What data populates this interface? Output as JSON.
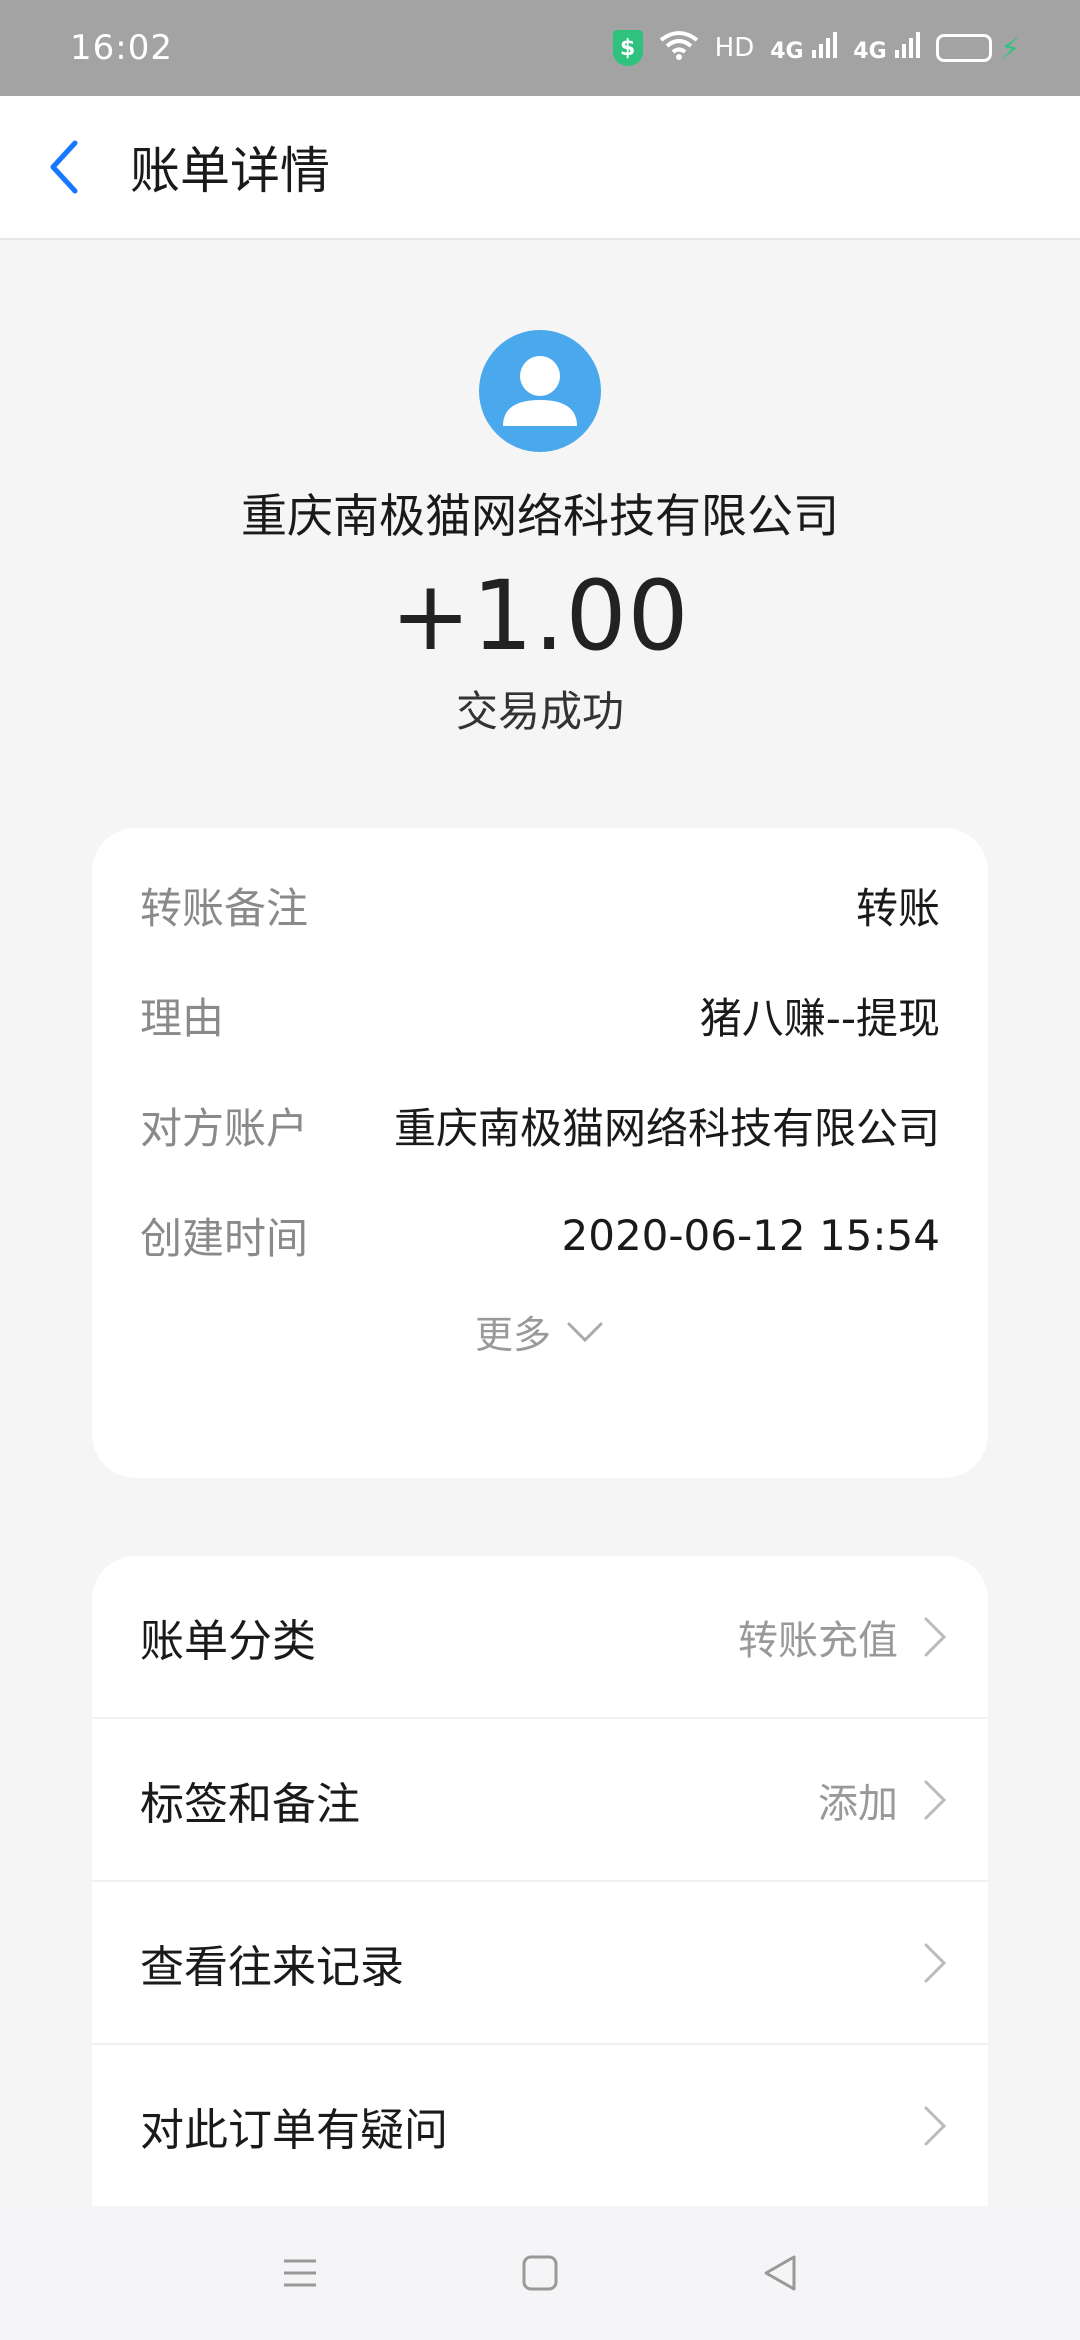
{
  "status_bar": {
    "time": "16:02",
    "network_label": "HD",
    "signal1": "4G",
    "signal2": "4G",
    "shield_icon": "shield-dollar-icon",
    "battery_color": "#f4c20d",
    "charging_color": "#2ec27e"
  },
  "header_bar": {
    "title": "账单详情"
  },
  "transaction": {
    "payee": "重庆南极猫网络科技有限公司",
    "amount": "+1.00",
    "status": "交易成功",
    "avatar_color": "#4aa8ec"
  },
  "details": {
    "rows": [
      {
        "label": "转账备注",
        "value": "转账"
      },
      {
        "label": "理由",
        "value": "猪八赚--提现"
      },
      {
        "label": "对方账户",
        "value": "重庆南极猫网络科技有限公司"
      },
      {
        "label": "创建时间",
        "value": "2020-06-12 15:54"
      }
    ],
    "more_label": "更多"
  },
  "menu": {
    "items": [
      {
        "label": "账单分类",
        "value": "转账充值"
      },
      {
        "label": "标签和备注",
        "value": "添加"
      },
      {
        "label": "查看往来记录",
        "value": ""
      },
      {
        "label": "对此订单有疑问",
        "value": ""
      }
    ]
  },
  "accent_color": "#1677ff"
}
